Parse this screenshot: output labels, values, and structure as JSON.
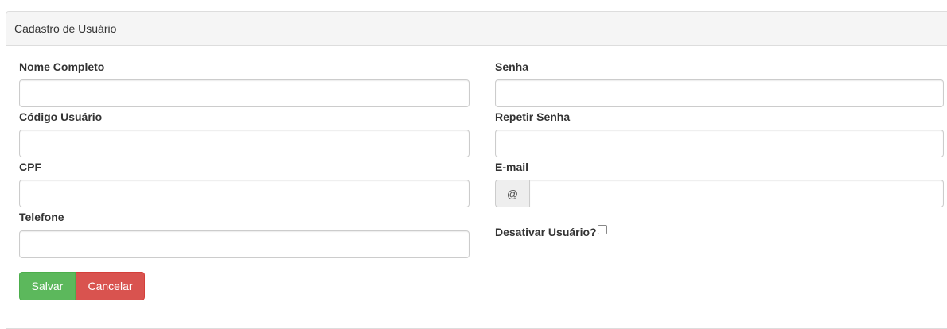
{
  "panel": {
    "title": "Cadastro de Usuário"
  },
  "form": {
    "nome_completo": {
      "label": "Nome Completo",
      "value": ""
    },
    "codigo_usuario": {
      "label": "Código Usuário",
      "value": ""
    },
    "cpf": {
      "label": "CPF",
      "value": ""
    },
    "telefone": {
      "label": "Telefone",
      "value": ""
    },
    "senha": {
      "label": "Senha",
      "value": ""
    },
    "repetir_senha": {
      "label": "Repetir Senha",
      "value": ""
    },
    "email": {
      "label": "E-mail",
      "addon": "@",
      "value": ""
    },
    "desativar": {
      "label": "Desativar Usuário?",
      "checked": false
    }
  },
  "buttons": {
    "save_label": "Salvar",
    "cancel_label": "Cancelar"
  },
  "colors": {
    "success": "#5cb85c",
    "danger": "#d9534f",
    "panel_heading_bg": "#f5f5f5",
    "border": "#dddddd"
  }
}
